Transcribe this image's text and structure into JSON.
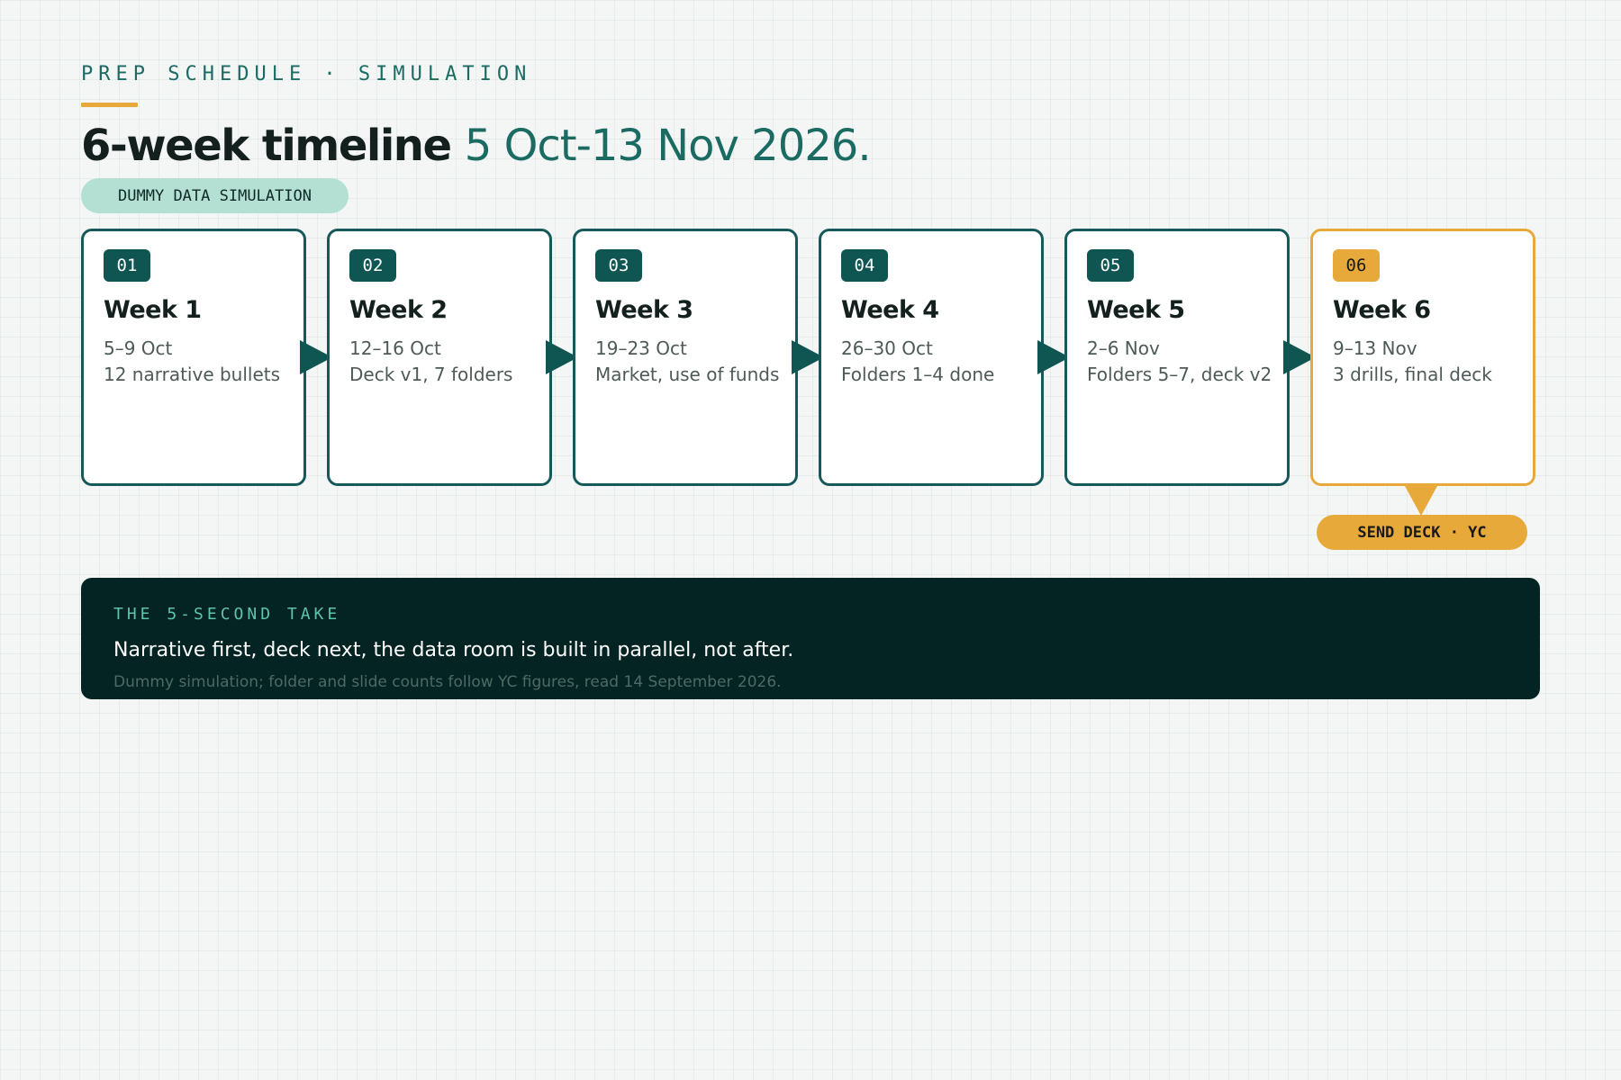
{
  "header": {
    "eyebrow": "PREP SCHEDULE · SIMULATION",
    "title_main": "6-week timeline",
    "title_accent": "5 Oct-13 Nov 2026.",
    "pill": "DUMMY DATA SIMULATION"
  },
  "weeks": [
    {
      "num": "01",
      "title": "Week 1",
      "dates": "5–9 Oct",
      "task": "12 narrative bullets"
    },
    {
      "num": "02",
      "title": "Week 2",
      "dates": "12–16 Oct",
      "task": "Deck v1, 7 folders"
    },
    {
      "num": "03",
      "title": "Week 3",
      "dates": "19–23 Oct",
      "task": "Market, use of funds"
    },
    {
      "num": "04",
      "title": "Week 4",
      "dates": "26–30 Oct",
      "task": "Folders 1–4 done"
    },
    {
      "num": "05",
      "title": "Week 5",
      "dates": "2–6 Nov",
      "task": "Folders 5–7, deck v2"
    },
    {
      "num": "06",
      "title": "Week 6",
      "dates": "9–13 Nov",
      "task": "3 drills, final deck"
    }
  ],
  "milestone": {
    "label": "SEND DECK · YC"
  },
  "take": {
    "label": "THE 5-SECOND TAKE",
    "text": "Narrative first, deck next, the data room is built in parallel, not after.",
    "note": "Dummy simulation; folder and slide counts follow YC figures, read 14 September 2026."
  },
  "colors": {
    "teal_dark": "#0f5652",
    "accent_amber": "#e6a93a",
    "take_bg": "#032422",
    "pill_mint": "#b3e0d3"
  }
}
